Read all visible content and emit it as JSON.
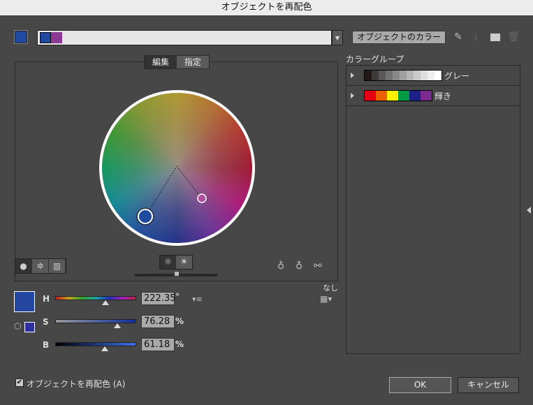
{
  "title": "オブジェクトを再配色",
  "toolbar": {
    "object_color_label": "オブジェクトのカラー"
  },
  "tabs": [
    {
      "label": "編集"
    },
    {
      "label": "指定"
    }
  ],
  "color_group": {
    "title": "カラーグループ",
    "groups": [
      {
        "label": "グレー",
        "colors": [
          "#231815",
          "#3e3a39",
          "#595757",
          "#727171",
          "#898989",
          "#9fa0a0",
          "#b5b5b6",
          "#c9caca",
          "#dcdddd",
          "#efefef",
          "#ffffff"
        ]
      },
      {
        "label": "輝き",
        "colors": [
          "#e60012",
          "#eb6100",
          "#fff100",
          "#009944",
          "#1d2088",
          "#7b2a8e"
        ]
      }
    ]
  },
  "hsb": {
    "h_label": "H",
    "s_label": "S",
    "b_label": "B",
    "h": "222.35",
    "s": "76.28",
    "b": "61.18",
    "h_unit": "°",
    "pct": "%",
    "h_frac": 0.618,
    "s_frac": 0.763,
    "b_frac": 0.612
  },
  "none_label": "なし",
  "recolor_checkbox": {
    "label": "オブジェクトを再配色 (A)",
    "checked": true
  },
  "buttons": {
    "ok": "OK",
    "cancel": "キャンセル"
  },
  "colors": {
    "base": "#2347a0",
    "secondary": "#8c3a96"
  }
}
